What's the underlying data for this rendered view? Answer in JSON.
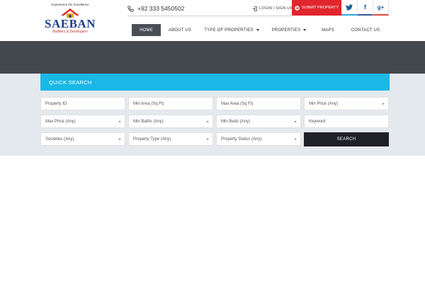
{
  "logo": {
    "tagline": "Experience the Excellence",
    "name": "SAEBAN",
    "subtitle": "Builders & Developers",
    "colors": {
      "name": "#1a3f8c",
      "roof": "#e0262c"
    }
  },
  "topbar": {
    "phone_icon": "phone-icon",
    "phone": "+92 333 5450502",
    "login_icon": "login-icon",
    "login": "LOGIN / SIGN UP",
    "submit_icon": "plus-circle-icon",
    "submit": "SUBMIT PROPERTY",
    "social": {
      "twitter": "𝕥",
      "facebook": "f",
      "googleplus": "g+"
    }
  },
  "nav": {
    "items": [
      {
        "label": "HOME",
        "active": true
      },
      {
        "label": "ABOUT US"
      },
      {
        "label": "TYPE OF PROPERTIES",
        "dropdown": true
      },
      {
        "label": "PROPERTIES",
        "dropdown": true
      },
      {
        "label": "MAPS"
      },
      {
        "label": "CONTACT US"
      }
    ]
  },
  "quick_search": {
    "title": "QUICK SEARCH",
    "fields": {
      "property_id": "Property ID",
      "min_area": "Min Area (Sq Ft)",
      "max_area": "Max Area (Sq Ft)",
      "min_price": "Min Price (Any)",
      "max_price": "Max Price (Any)",
      "min_baths": "Min Baths (Any)",
      "min_beds": "Min Beds (Any)",
      "keyword": "Keyword",
      "societies": "Societies (Any)",
      "property_type": "Property Type (Any)",
      "property_status": "Property Status (Any)"
    },
    "search_button": "SEARCH"
  },
  "colors": {
    "accent": "#1ab8e6",
    "submit": "#e0262c",
    "banner": "#43474e",
    "nav_active": "#4a4f57",
    "search_button": "#1f2126",
    "band": "#e4e9ee"
  }
}
